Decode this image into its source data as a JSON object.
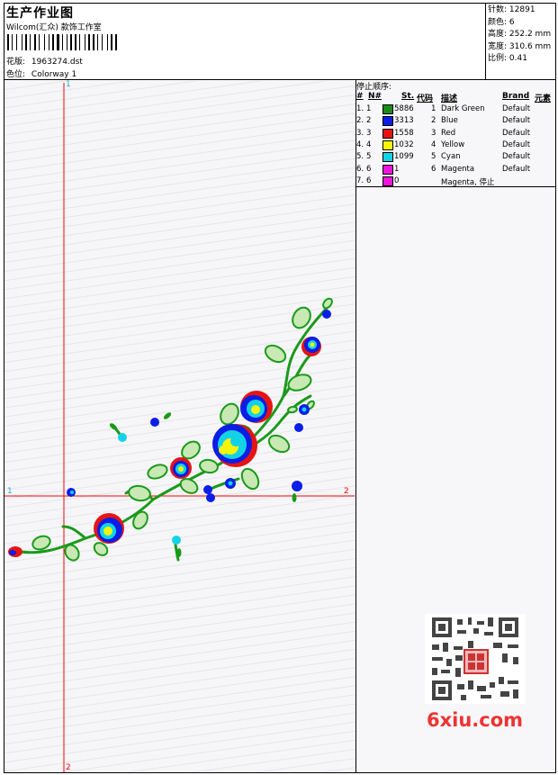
{
  "header": {
    "title": "生产作业图",
    "subtitle": "Wilcom(汇众) 款饰工作室",
    "pattern_label": "花版:",
    "pattern_value": "1963274.dst",
    "colorway_label": "色位:",
    "colorway_value": "Colorway 1"
  },
  "stats": [
    {
      "label": "针数:",
      "value": "12891"
    },
    {
      "label": "颜色:",
      "value": "6"
    },
    {
      "label": "高度:",
      "value": "252.2 mm"
    },
    {
      "label": "宽度:",
      "value": "310.6 mm"
    },
    {
      "label": "比例:",
      "value": "0.41"
    }
  ],
  "stop_sequence": {
    "caption": "停止顺序:",
    "columns": [
      "#",
      "N#",
      "St.",
      "代码",
      "描述",
      "Brand",
      "元素"
    ],
    "rows": [
      {
        "idx": "1.",
        "n": "1",
        "color": "#1a8c1a",
        "st": "5886",
        "code": "1",
        "desc": "Dark Green",
        "brand": "Default"
      },
      {
        "idx": "2.",
        "n": "2",
        "color": "#0a1ee6",
        "st": "3313",
        "code": "2",
        "desc": "Blue",
        "brand": "Default"
      },
      {
        "idx": "3.",
        "n": "3",
        "color": "#e61414",
        "st": "1558",
        "code": "3",
        "desc": "Red",
        "brand": "Default"
      },
      {
        "idx": "4.",
        "n": "4",
        "color": "#f5f50a",
        "st": "1032",
        "code": "4",
        "desc": "Yellow",
        "brand": "Default"
      },
      {
        "idx": "5.",
        "n": "5",
        "color": "#14d2e6",
        "st": "1099",
        "code": "5",
        "desc": "Cyan",
        "brand": "Default"
      },
      {
        "idx": "6.",
        "n": "6",
        "color": "#ee14dc",
        "st": "1",
        "code": "6",
        "desc": "Magenta",
        "brand": "Default"
      },
      {
        "idx": "7.",
        "n": "6",
        "color": "#ee14dc",
        "st": "0",
        "code": "",
        "desc": "Magenta, 停止",
        "brand": ""
      }
    ]
  },
  "axes": {
    "x_start": "1",
    "x_end": "2",
    "y_start": "1",
    "y_end": "2",
    "color": "#ff0000"
  },
  "watermark": {
    "text": "6xiu.com",
    "color": "#ee3333"
  }
}
